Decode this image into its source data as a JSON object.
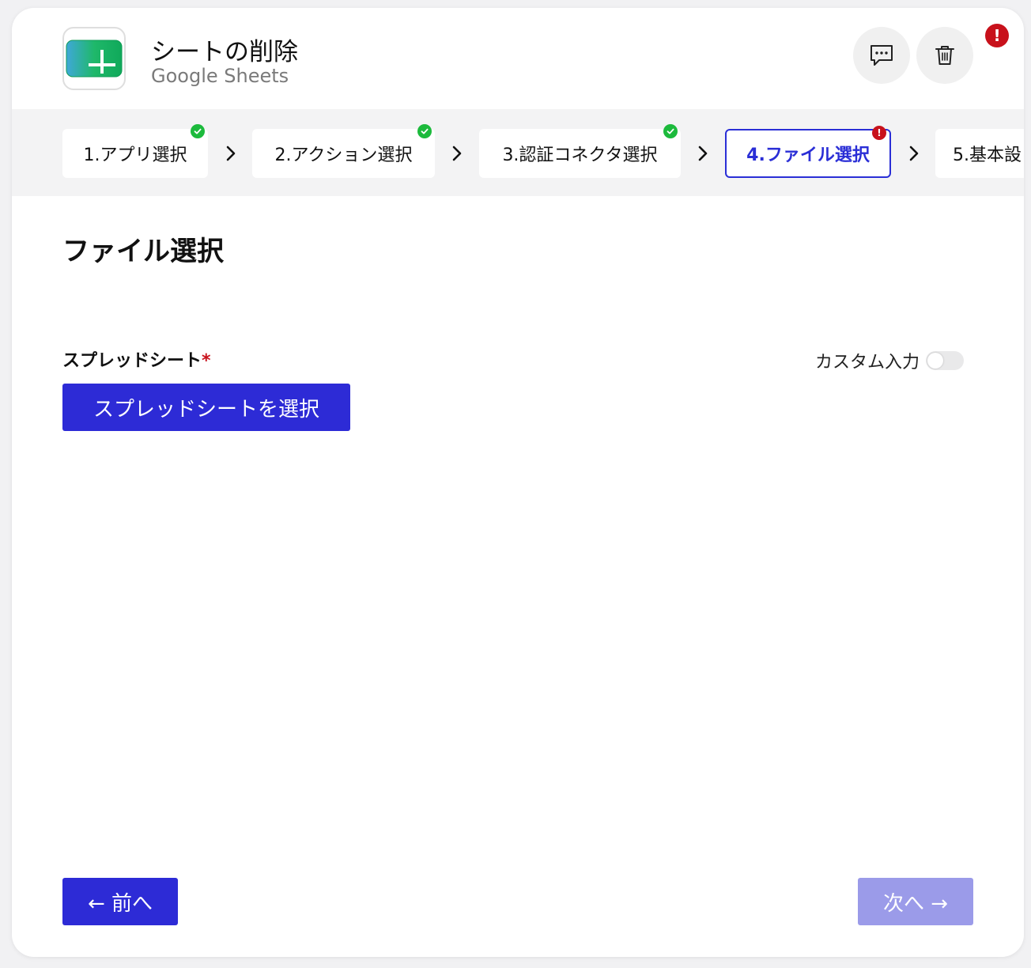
{
  "header": {
    "title": "シートの削除",
    "subtitle": "Google Sheets",
    "app_icon": "google-sheets-icon",
    "comment_icon": "comment-icon",
    "trash_icon": "trash-icon",
    "alert_badge": "!"
  },
  "steps": [
    {
      "label": "1.アプリ選択",
      "status": "complete"
    },
    {
      "label": "2.アクション選択",
      "status": "complete"
    },
    {
      "label": "3.認証コネクタ選択",
      "status": "complete"
    },
    {
      "label": "4.ファイル選択",
      "status": "error",
      "active": true
    },
    {
      "label": "5.基本設",
      "status": "pending"
    }
  ],
  "step_error_mark": "!",
  "section": {
    "title": "ファイル選択"
  },
  "field": {
    "label": "スプレッドシート",
    "required_mark": "*",
    "custom_input_label": "カスタム入力",
    "custom_input_enabled": false,
    "select_button": "スプレッドシートを選択"
  },
  "footer": {
    "prev_label": "← 前へ",
    "next_label": "次へ →"
  },
  "colors": {
    "primary": "#2d2bd6",
    "primary_disabled": "#9b9be9",
    "success": "#1cba3c",
    "error": "#c8111b"
  }
}
